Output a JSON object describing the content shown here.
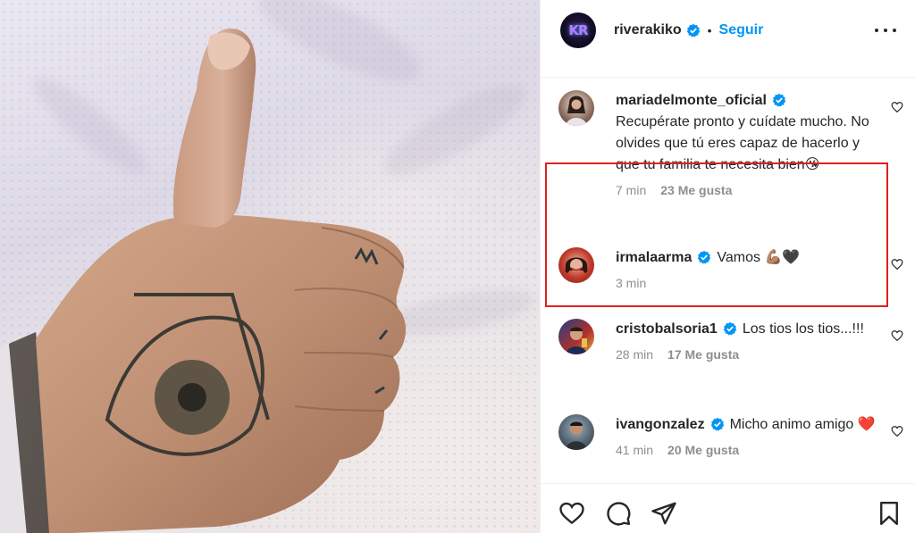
{
  "post": {
    "username": "riverakiko",
    "separator": "•",
    "follow_label": "Seguir",
    "avatar_initials": "KR"
  },
  "comments": [
    {
      "username": "mariadelmonte_oficial",
      "text": "Recupérate pronto y cuídate mucho. No olvides que tú eres capaz de hacerlo y que tu familia te necesita bien😘",
      "time": "7 min",
      "likes": "23 Me gusta",
      "highlighted": true
    },
    {
      "username": "irmalaarma",
      "text": "Vamos 💪🏽🖤",
      "time": "3 min",
      "likes": ""
    },
    {
      "username": "cristobalsoria1",
      "text": "Los tios los tios...!!!",
      "time": "28 min",
      "likes": "17 Me gusta"
    },
    {
      "username": "ivangonzalez",
      "text": "Micho animo amigo ❤️",
      "time": "41 min",
      "likes": "20 Me gusta"
    }
  ],
  "colors": {
    "accent": "#0095f6",
    "verified": "#0095f6",
    "highlight_box": "#e02020",
    "muted_text": "#8e8e8e"
  },
  "icons": [
    "verified-badge-icon",
    "more-options-icon",
    "heart-icon",
    "comment-icon",
    "share-icon",
    "bookmark-icon"
  ]
}
